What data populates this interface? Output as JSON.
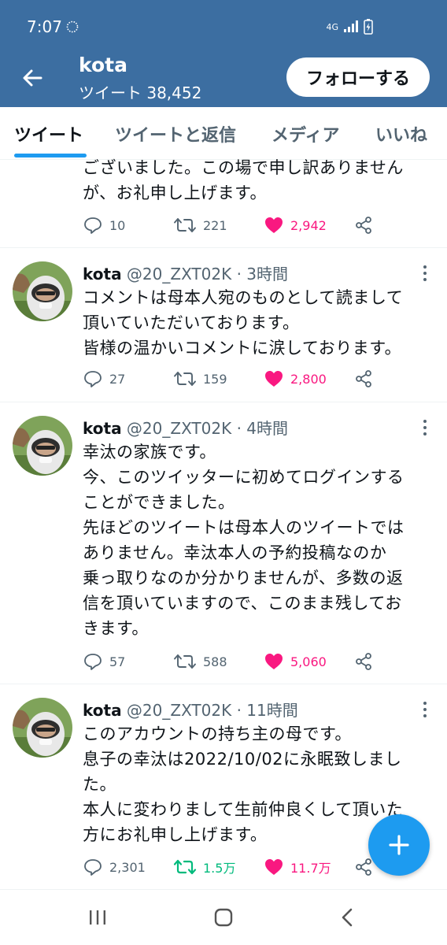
{
  "status_bar": {
    "time": "7:07",
    "network": "4G"
  },
  "header": {
    "name": "kota",
    "tweet_count": "ツイート 38,452",
    "follow_label": "フォローする"
  },
  "tabs": [
    {
      "label": "ツイート",
      "active": true
    },
    {
      "label": "ツイートと返信",
      "active": false
    },
    {
      "label": "メディア",
      "active": false
    },
    {
      "label": "いいね",
      "active": false
    }
  ],
  "partial_tweet": {
    "lines": [
      "ございました。この場で申し訳ありません",
      "が、お礼申し上げます。"
    ],
    "replies": "10",
    "retweets": "221",
    "likes": "2,942"
  },
  "tweets": [
    {
      "name": "kota",
      "handle": "@20_ZXT02K",
      "time": "· 3時間",
      "lines": [
        "コメントは母本人宛のものとして読まして",
        "頂いていただいております。",
        "皆様の温かいコメントに涙しております。"
      ],
      "replies": "27",
      "retweets": "159",
      "likes": "2,800"
    },
    {
      "name": "kota",
      "handle": "@20_ZXT02K",
      "time": "· 4時間",
      "lines": [
        "幸汰の家族です。",
        "今、このツイッターに初めてログインする",
        "ことができました。",
        "先ほどのツイートは母本人のツイートでは",
        "ありません。幸汰本人の予約投稿なのか",
        "乗っ取りなのか分かりませんが、多数の返",
        "信を頂いていますので、このまま残してお",
        "きます。"
      ],
      "replies": "57",
      "retweets": "588",
      "likes": "5,060"
    },
    {
      "name": "kota",
      "handle": "@20_ZXT02K",
      "time": "· 11時間",
      "lines": [
        "このアカウントの持ち主の母です。",
        "息子の幸汰は2022/10/02に永眠致しまし",
        "た。",
        "本人に変わりまして生前仲良くして頂いた",
        "方にお礼申し上げます。"
      ],
      "replies": "2,301",
      "retweets": "1.5万",
      "likes": "11.7万"
    }
  ],
  "colors": {
    "header_bg": "#3c6ea1",
    "accent": "#1d9bf0",
    "like": "#f91880",
    "retweet_active": "#00ba7c",
    "muted": "#536471"
  }
}
